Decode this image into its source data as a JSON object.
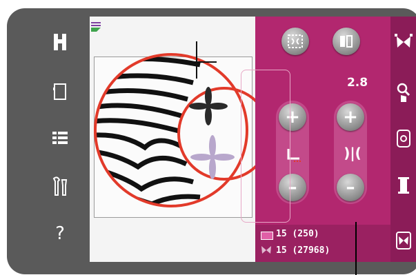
{
  "left_toolbar": {
    "items": [
      {
        "name": "home-icon"
      },
      {
        "name": "frame-icon"
      },
      {
        "name": "menu-list-icon"
      },
      {
        "name": "tools-icon"
      },
      {
        "name": "help-icon",
        "label": "?"
      }
    ]
  },
  "stitch_panel": {
    "value": "2.8",
    "plus": "+",
    "minus": "–"
  },
  "thread_info": {
    "color_count": "15 (250)",
    "stitch_count": "15 (27968)"
  },
  "colors": {
    "panel": "#b2276f",
    "hoop_outline": "#e23a2a"
  }
}
